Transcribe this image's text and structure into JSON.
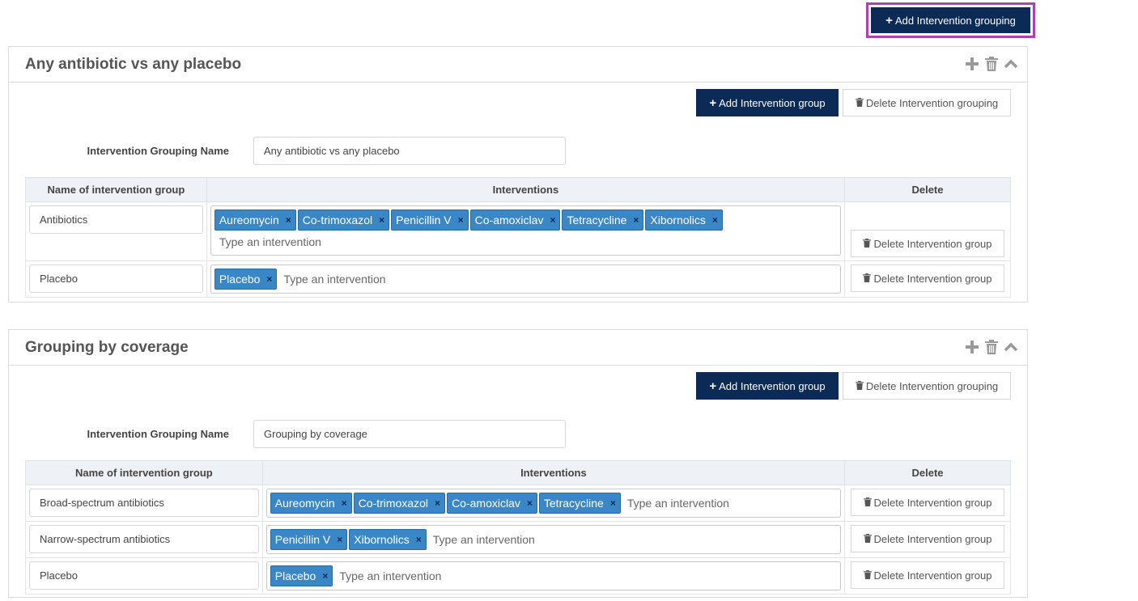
{
  "top": {
    "add_grouping_label": "Add Intervention grouping"
  },
  "panels": [
    {
      "title": "Any antibiotic vs any placebo",
      "add_group_label": "Add Intervention group",
      "delete_grouping_label": "Delete Intervention grouping",
      "name_label": "Intervention Grouping Name",
      "name_value": "Any antibiotic vs any placebo",
      "columns": [
        "Name of intervention group",
        "Interventions",
        "Delete"
      ],
      "rows": [
        {
          "name": "Antibiotics",
          "tags": [
            "Aureomycin",
            "Co-trimoxazol",
            "Penicillin V",
            "Co-amoxiclav",
            "Tetracycline",
            "Xibornolics"
          ],
          "placeholder": "Type an intervention",
          "delete_label": "Delete Intervention group"
        },
        {
          "name": "Placebo",
          "tags": [
            "Placebo"
          ],
          "placeholder": "Type an intervention",
          "delete_label": "Delete Intervention group"
        }
      ]
    },
    {
      "title": "Grouping by coverage",
      "add_group_label": "Add Intervention group",
      "delete_grouping_label": "Delete Intervention grouping",
      "name_label": "Intervention Grouping Name",
      "name_value": "Grouping by coverage",
      "columns": [
        "Name of intervention group",
        "Interventions",
        "Delete"
      ],
      "rows": [
        {
          "name": "Broad-spectrum antibiotics",
          "tags": [
            "Aureomycin",
            "Co-trimoxazol",
            "Co-amoxiclav",
            "Tetracycline"
          ],
          "placeholder": "Type an intervention",
          "delete_label": "Delete Intervention group"
        },
        {
          "name": "Narrow-spectrum antibiotics",
          "tags": [
            "Penicillin V",
            "Xibornolics"
          ],
          "placeholder": "Type an intervention",
          "delete_label": "Delete Intervention group"
        },
        {
          "name": "Placebo",
          "tags": [
            "Placebo"
          ],
          "placeholder": "Type an intervention",
          "delete_label": "Delete Intervention group"
        }
      ]
    }
  ]
}
